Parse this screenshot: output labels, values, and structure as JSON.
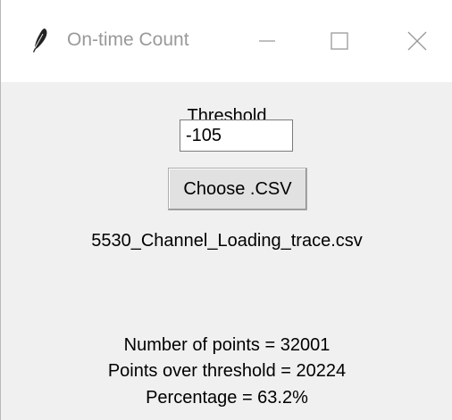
{
  "window": {
    "title": "On-time Count",
    "controls": {
      "minimize_icon": "minimize-icon",
      "maximize_icon": "maximize-icon",
      "close_icon": "close-icon"
    },
    "app_icon": "feather-icon"
  },
  "form": {
    "threshold_label": "Threshold",
    "threshold_value": "-105",
    "choose_button_label": "Choose .CSV",
    "selected_file": "5530_Channel_Loading_trace.csv"
  },
  "results": {
    "points_line": "Number of points = 32001",
    "over_threshold_line": "Points over threshold = 20224",
    "percentage_line": "Percentage = 63.2%"
  },
  "colors": {
    "window_background": "#f0f0f0",
    "titlebar_background": "#ffffff",
    "title_text": "#999999",
    "button_background": "#e1e1e1"
  }
}
